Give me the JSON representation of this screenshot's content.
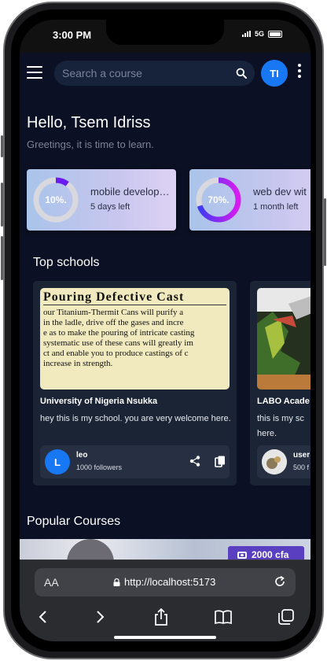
{
  "status": {
    "time": "3:00 PM",
    "network": "5G"
  },
  "appbar": {
    "search_placeholder": "Search a course",
    "avatar_initials": "TI"
  },
  "greeting": {
    "title": "Hello, Tsem Idriss",
    "subtitle": "Greetings, it is time to learn."
  },
  "courses": [
    {
      "title": "mobile develop…",
      "time_left": "5 days left",
      "progress_label": "10%.",
      "progress": 0.1
    },
    {
      "title": "web dev wit",
      "time_left": "1 month left",
      "progress_label": "70%.",
      "progress": 0.7
    }
  ],
  "top_schools": {
    "title": "Top schools",
    "items": [
      {
        "name": "University of Nigeria Nsukka",
        "description": "hey this is my school. you are very welcome here.",
        "image_headline": "Pouring Defective Cast",
        "image_text": [
          "our Titanium-Thermit Cans will purify a",
          "in the ladle, drive off the gases and incre",
          "e as to make the pouring of intricate casting",
          "systematic use of these cans will greatly im",
          "ct and enable you to produce castings of c",
          "increase in strength."
        ],
        "owner": {
          "initial": "L",
          "name": "leo",
          "followers": "1000 followers"
        }
      },
      {
        "name": "LABO Acade",
        "description": "this is my sc here.",
        "owner": {
          "name": "user",
          "followers": "500 f"
        }
      }
    ]
  },
  "popular_courses": {
    "title": "Popular Courses",
    "price": "2000 cfa"
  },
  "browser": {
    "text_size_label": "AA",
    "url": "http://localhost:5173"
  },
  "colors": {
    "background": "#0b1024",
    "accent": "#1877f2",
    "progress_ring": "#7c3aed",
    "card": "#1a2435"
  }
}
